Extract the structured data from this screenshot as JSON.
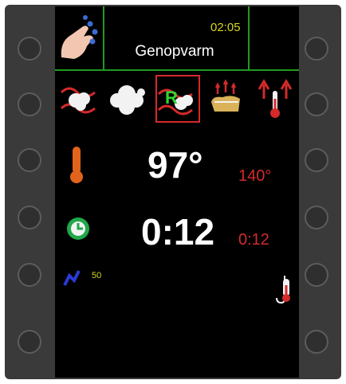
{
  "header": {
    "time": "02:05",
    "mode": "Genopvarm"
  },
  "program_icons": [
    "steam-heat-icon",
    "steam-icon",
    "reheat-steam-icon",
    "bake-icon",
    "dry-heat-icon"
  ],
  "readings": {
    "temperature": {
      "value": "97°",
      "set": "140°"
    },
    "time": {
      "value": "0:12",
      "set": "0:12"
    },
    "volume": {
      "value": "50"
    }
  },
  "colors": {
    "accent_green": "#1f9a1f",
    "time_yellow": "#d6d61e",
    "setpoint_red": "#d42a2a"
  }
}
